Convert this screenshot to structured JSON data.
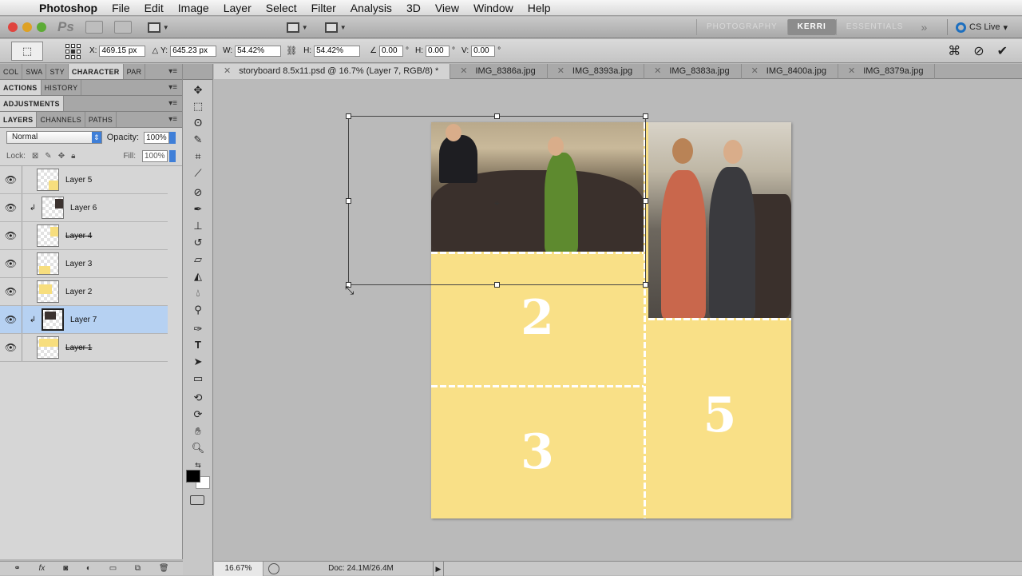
{
  "menubar": {
    "app": "Photoshop",
    "items": [
      "File",
      "Edit",
      "Image",
      "Layer",
      "Select",
      "Filter",
      "Analysis",
      "3D",
      "View",
      "Window",
      "Help"
    ]
  },
  "appbar": {
    "logo": "Ps",
    "workspaces": [
      "PHOTOGRAPHY",
      "KERRI",
      "ESSENTIALS"
    ],
    "more": "»",
    "cs_live": "CS Live"
  },
  "options": {
    "x_label": "X:",
    "x_value": "469.15 px",
    "y_label": "Y:",
    "y_value": "645.23 px",
    "w_label": "W:",
    "w_value": "54.42%",
    "h_label": "H:",
    "h_value": "54.42%",
    "angle_value": "0.00",
    "hskew_label": "H:",
    "hskew_value": "0.00",
    "vskew_label": "V:",
    "vskew_value": "0.00",
    "degree": "°"
  },
  "panels": {
    "row1": [
      "COL",
      "SWA",
      "STY",
      "CHARACTER",
      "PAR"
    ],
    "row2": [
      "ACTIONS",
      "HISTORY"
    ],
    "row3": [
      "ADJUSTMENTS"
    ],
    "row4": [
      "LAYERS",
      "CHANNELS",
      "PATHS"
    ],
    "blend_mode": "Normal",
    "opacity_label": "Opacity:",
    "opacity_value": "100%",
    "lock_label": "Lock:",
    "fill_label": "Fill:",
    "fill_value": "100%"
  },
  "layers": [
    {
      "name": "Layer 5",
      "clipped": false,
      "selected": false,
      "strike": false
    },
    {
      "name": "Layer 6",
      "clipped": true,
      "selected": false,
      "strike": false
    },
    {
      "name": "Layer 4",
      "clipped": false,
      "selected": false,
      "strike": true
    },
    {
      "name": "Layer 3",
      "clipped": false,
      "selected": false,
      "strike": false
    },
    {
      "name": "Layer 2",
      "clipped": false,
      "selected": false,
      "strike": false
    },
    {
      "name": "Layer 7",
      "clipped": true,
      "selected": true,
      "strike": false
    },
    {
      "name": "Layer 1",
      "clipped": false,
      "selected": false,
      "strike": true
    }
  ],
  "doc_tabs": [
    {
      "label": "storyboard 8.5x11.psd @ 16.7% (Layer 7, RGB/8) *",
      "active": true
    },
    {
      "label": "IMG_8386a.jpg",
      "active": false
    },
    {
      "label": "IMG_8393a.jpg",
      "active": false
    },
    {
      "label": "IMG_8383a.jpg",
      "active": false
    },
    {
      "label": "IMG_8400a.jpg",
      "active": false
    },
    {
      "label": "IMG_8379a.jpg",
      "active": false
    }
  ],
  "document": {
    "panel_numbers": [
      "2",
      "3",
      "5"
    ],
    "colors": {
      "yellow": "#f9e087",
      "canvas": "#bababa"
    }
  },
  "status": {
    "zoom": "16.67%",
    "doc_info": "Doc: 24.1M/26.4M"
  }
}
